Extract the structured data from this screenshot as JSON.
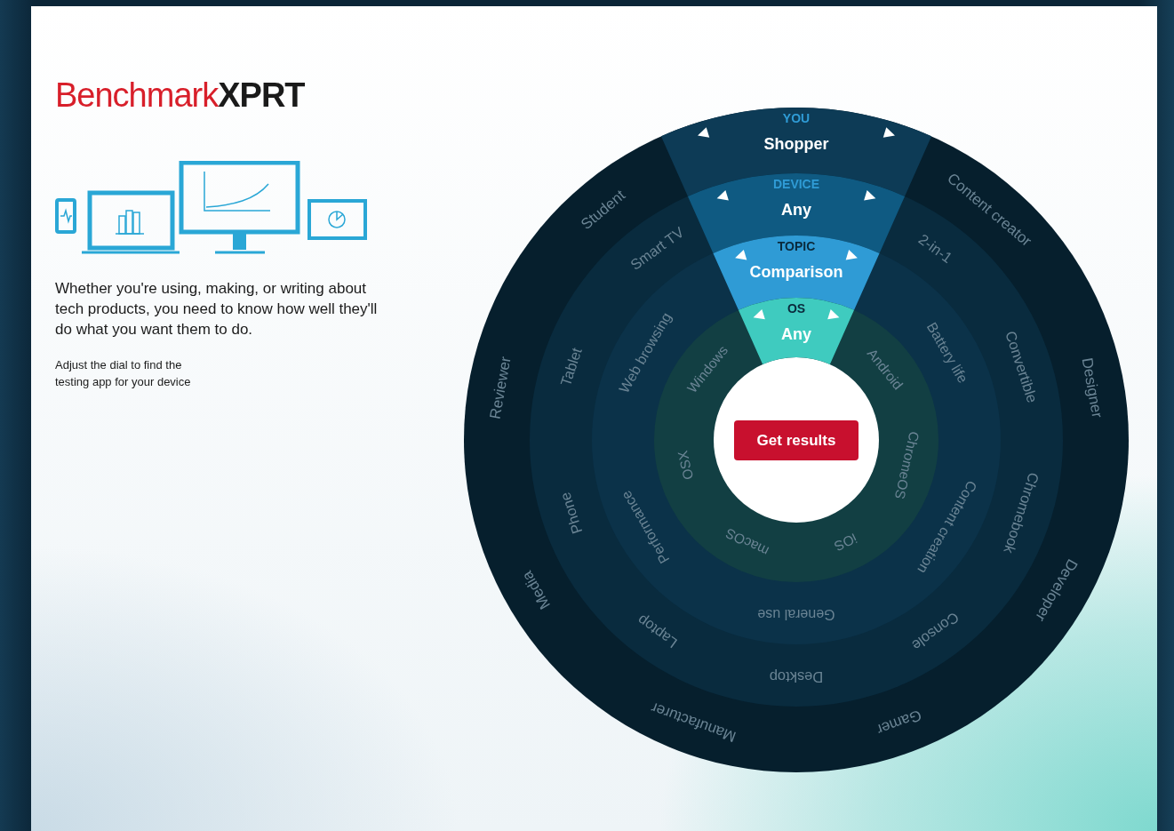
{
  "logo": "Benchmark**XPRT**",
  "intro": "Whether you're using, making, or writing about tech products, you need to know how well they'll do what you want them to do.",
  "hint": "Adjust the dial to find the\ntesting app for your device",
  "dial": {
    "button": "Get results",
    "rings": [
      {
        "title": "YOU",
        "options": [
          {
            "label": "Shopper",
            "selected": true
          },
          {
            "label": "Content creator",
            "selected": false
          },
          {
            "label": "Designer",
            "selected": false
          },
          {
            "label": "Developer",
            "selected": false
          },
          {
            "label": "Gamer",
            "selected": false
          },
          {
            "label": "Manufacturer",
            "selected": false
          },
          {
            "label": "Media",
            "selected": false
          },
          {
            "label": "Reviewer",
            "selected": false
          },
          {
            "label": "Student",
            "selected": false
          }
        ]
      },
      {
        "title": "DEVICE",
        "options": [
          {
            "label": "Any",
            "selected": true
          },
          {
            "label": "2-in-1",
            "selected": false
          },
          {
            "label": "Convertible",
            "selected": false
          },
          {
            "label": "Chromebook",
            "selected": false
          },
          {
            "label": "Console",
            "selected": false
          },
          {
            "label": "Desktop",
            "selected": false
          },
          {
            "label": "Laptop",
            "selected": false
          },
          {
            "label": "Phone",
            "selected": false
          },
          {
            "label": "Tablet",
            "selected": false
          },
          {
            "label": "Smart TV",
            "selected": false
          }
        ]
      },
      {
        "title": "TOPIC",
        "options": [
          {
            "label": "Comparison",
            "selected": true
          },
          {
            "label": "Battery life",
            "selected": false
          },
          {
            "label": "Content creation",
            "selected": false
          },
          {
            "label": "General use",
            "selected": false
          },
          {
            "label": "Performance",
            "selected": false
          },
          {
            "label": "Web browsing",
            "selected": false
          }
        ]
      },
      {
        "title": "OS",
        "options": [
          {
            "label": "Any",
            "selected": true
          },
          {
            "label": "Android",
            "selected": false
          },
          {
            "label": "ChromeOS",
            "selected": false
          },
          {
            "label": "iOS",
            "selected": false
          },
          {
            "label": "macOS",
            "selected": false
          },
          {
            "label": "OSX",
            "selected": false
          },
          {
            "label": "Windows",
            "selected": false
          }
        ]
      }
    ]
  }
}
